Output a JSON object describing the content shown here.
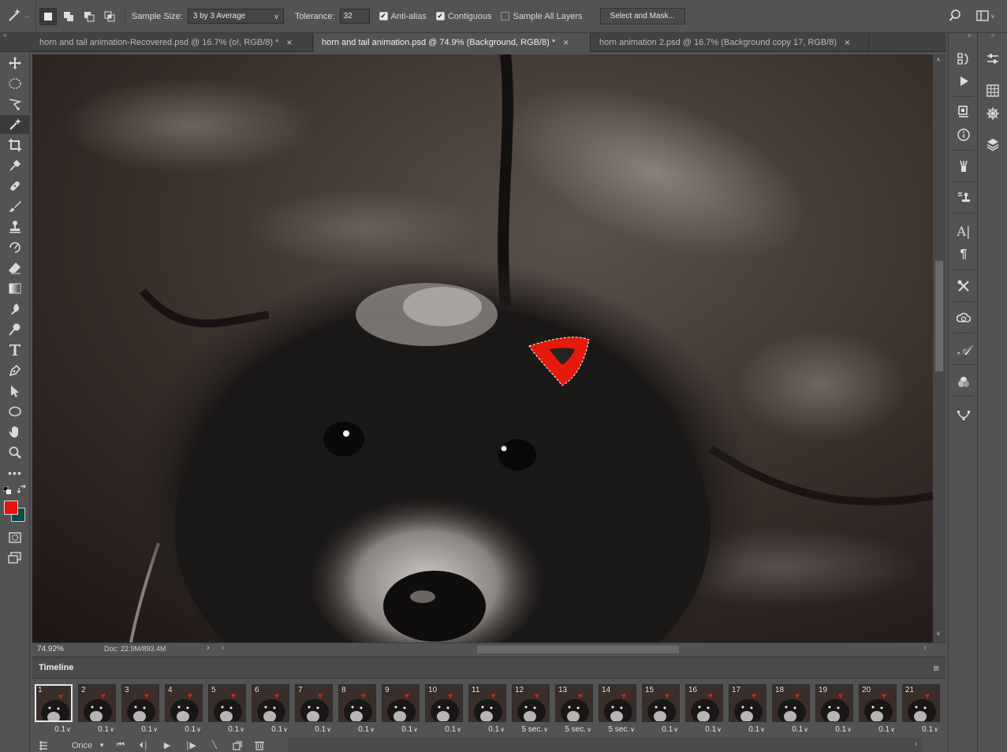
{
  "options_bar": {
    "sample_size_label": "Sample Size:",
    "sample_size_value": "3 by 3 Average",
    "tolerance_label": "Tolerance:",
    "tolerance_value": "32",
    "anti_alias_label": "Anti-alias",
    "anti_alias_checked": true,
    "contiguous_label": "Contiguous",
    "contiguous_checked": true,
    "sample_all_layers_label": "Sample All Layers",
    "sample_all_layers_checked": false,
    "select_and_mask_label": "Select and Mask..."
  },
  "tabs": [
    {
      "label": "horn and tail animation-Recovered.psd @ 16.7% (o!, RGB/8) *",
      "active": false
    },
    {
      "label": "horn and tail animation.psd @ 74.9% (Background, RGB/8) *",
      "active": true
    },
    {
      "label": "horn animation 2.psd @ 16.7% (Background copy 17, RGB/8)",
      "active": false
    }
  ],
  "toolbar": {
    "tools": [
      "move-tool",
      "marquee-tool",
      "lasso-tool",
      "magic-wand-tool",
      "crop-tool",
      "eyedropper-tool",
      "healing-brush-tool",
      "brush-tool",
      "clone-stamp-tool",
      "history-brush-tool",
      "eraser-tool",
      "gradient-tool",
      "blur-tool",
      "dodge-tool",
      "type-tool",
      "pen-tool",
      "path-selection-tool",
      "ellipse-tool",
      "hand-tool",
      "zoom-tool",
      "more-tools"
    ],
    "active_tool": "magic-wand-tool",
    "foreground_color": "#e8130c",
    "background_color": "#0f4a46"
  },
  "status_bar": {
    "zoom": "74.92%",
    "doc_info": "Doc: 22.9M/893.4M"
  },
  "timeline": {
    "title": "Timeline",
    "loop": "Once",
    "selected_frame": 1,
    "frames": [
      {
        "num": "1",
        "delay": "0.1"
      },
      {
        "num": "2",
        "delay": "0.1"
      },
      {
        "num": "3",
        "delay": "0.1"
      },
      {
        "num": "4",
        "delay": "0.1"
      },
      {
        "num": "5",
        "delay": "0.1"
      },
      {
        "num": "6",
        "delay": "0.1"
      },
      {
        "num": "7",
        "delay": "0.1"
      },
      {
        "num": "8",
        "delay": "0.1"
      },
      {
        "num": "9",
        "delay": "0.1"
      },
      {
        "num": "10",
        "delay": "0.1"
      },
      {
        "num": "11",
        "delay": "0.1"
      },
      {
        "num": "12",
        "delay": "5 sec."
      },
      {
        "num": "13",
        "delay": "5 sec."
      },
      {
        "num": "14",
        "delay": "5 sec."
      },
      {
        "num": "15",
        "delay": "0.1"
      },
      {
        "num": "16",
        "delay": "0.1"
      },
      {
        "num": "17",
        "delay": "0.1"
      },
      {
        "num": "18",
        "delay": "0.1"
      },
      {
        "num": "19",
        "delay": "0.1"
      },
      {
        "num": "20",
        "delay": "0.1"
      },
      {
        "num": "21",
        "delay": "0.1"
      }
    ]
  },
  "colors": {
    "ui_bg": "#535353",
    "selection_red": "#e61a0c"
  }
}
